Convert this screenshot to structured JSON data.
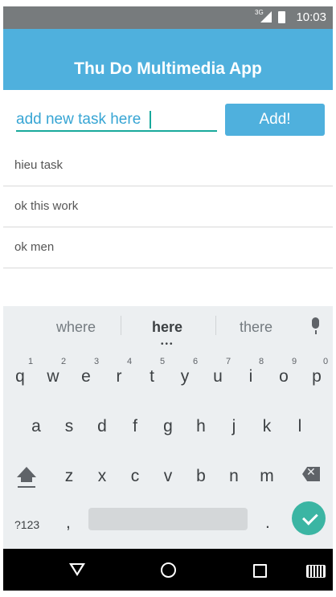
{
  "status_bar": {
    "network": "3G",
    "time": "10:03"
  },
  "app_bar": {
    "title": "Thu Do Multimedia App"
  },
  "input": {
    "value": "add new task here"
  },
  "add_button": {
    "label": "Add!"
  },
  "tasks": [
    "hieu task",
    "ok this work",
    "ok men"
  ],
  "keyboard": {
    "suggestions": [
      "where",
      "here",
      "there"
    ],
    "row1": [
      "q",
      "w",
      "e",
      "r",
      "t",
      "y",
      "u",
      "i",
      "o",
      "p"
    ],
    "row1_numbers": [
      "1",
      "2",
      "3",
      "4",
      "5",
      "6",
      "7",
      "8",
      "9",
      "0"
    ],
    "row2": [
      "a",
      "s",
      "d",
      "f",
      "g",
      "h",
      "j",
      "k",
      "l"
    ],
    "row3": [
      "z",
      "x",
      "c",
      "v",
      "b",
      "n",
      "m"
    ],
    "symbols_label": "?123",
    "comma": ",",
    "period": "."
  },
  "colors": {
    "app_bar": "#4fb0dd",
    "accent": "#18a99c",
    "enter": "#3bb5a3"
  },
  "icons": [
    "signal-icon",
    "battery-icon",
    "mic-icon",
    "shift-icon",
    "backspace-icon",
    "check-icon",
    "back-icon",
    "home-icon",
    "recents-icon",
    "keyboard-icon"
  ]
}
